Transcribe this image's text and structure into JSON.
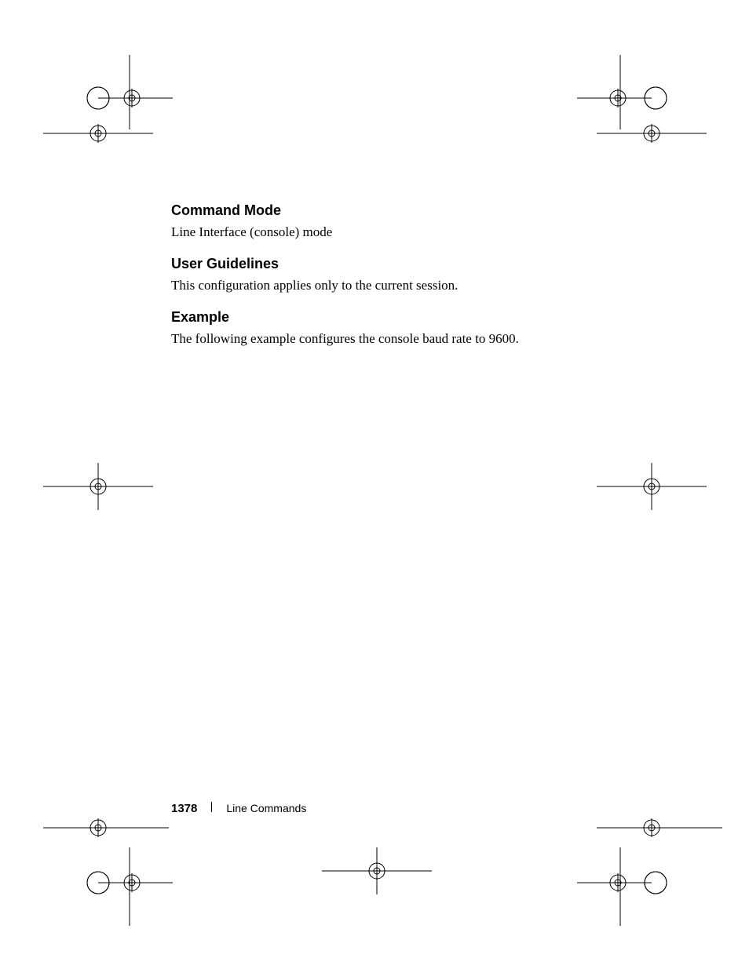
{
  "sections": {
    "command_mode": {
      "heading": "Command Mode",
      "body": "Line Interface (console) mode"
    },
    "user_guidelines": {
      "heading": "User Guidelines",
      "body": "This configuration applies only to the current session."
    },
    "example": {
      "heading": "Example",
      "body": "The following example configures the console baud rate to 9600."
    }
  },
  "footer": {
    "page_number": "1378",
    "section_name": "Line Commands"
  }
}
